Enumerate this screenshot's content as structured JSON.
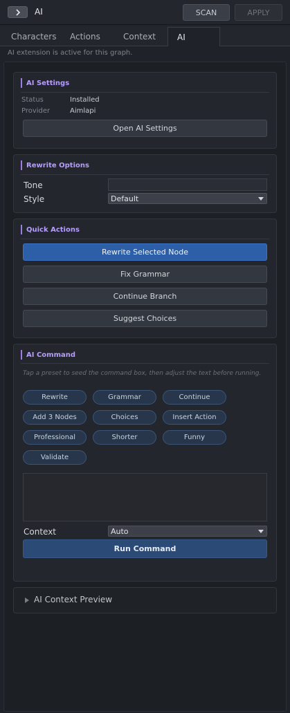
{
  "header": {
    "title": "AI",
    "scan_label": "SCAN",
    "apply_label": "APPLY"
  },
  "tabs": [
    {
      "label": "Characters",
      "active": false
    },
    {
      "label": "Actions",
      "active": false
    },
    {
      "label": "Context",
      "active": false
    },
    {
      "label": "AI",
      "active": true
    }
  ],
  "status_line": "AI extension is active for this graph.",
  "ai_settings": {
    "heading": "AI Settings",
    "status_label": "Status",
    "status_value": "Installed",
    "provider_label": "Provider",
    "provider_value": "Aimlapi",
    "open_button": "Open AI Settings"
  },
  "rewrite_options": {
    "heading": "Rewrite Options",
    "tone_label": "Tone",
    "tone_value": "",
    "style_label": "Style",
    "style_value": "Default"
  },
  "quick_actions": {
    "heading": "Quick Actions",
    "buttons": [
      "Rewrite Selected Node",
      "Fix Grammar",
      "Continue Branch",
      "Suggest Choices"
    ]
  },
  "ai_command": {
    "heading": "AI Command",
    "hint": "Tap a preset to seed the command box, then adjust the text before running.",
    "presets": [
      "Rewrite",
      "Grammar",
      "Continue",
      "Add 3 Nodes",
      "Choices",
      "Insert Action",
      "Professional",
      "Shorter",
      "Funny",
      "Validate"
    ],
    "command_text": "",
    "context_label": "Context",
    "context_value": "Auto",
    "run_button": "Run Command"
  },
  "context_preview": {
    "label": "AI Context Preview"
  },
  "colors": {
    "accent": "#b69dff",
    "primary_button": "#2d5fa8",
    "chip_border": "#3b5577"
  }
}
